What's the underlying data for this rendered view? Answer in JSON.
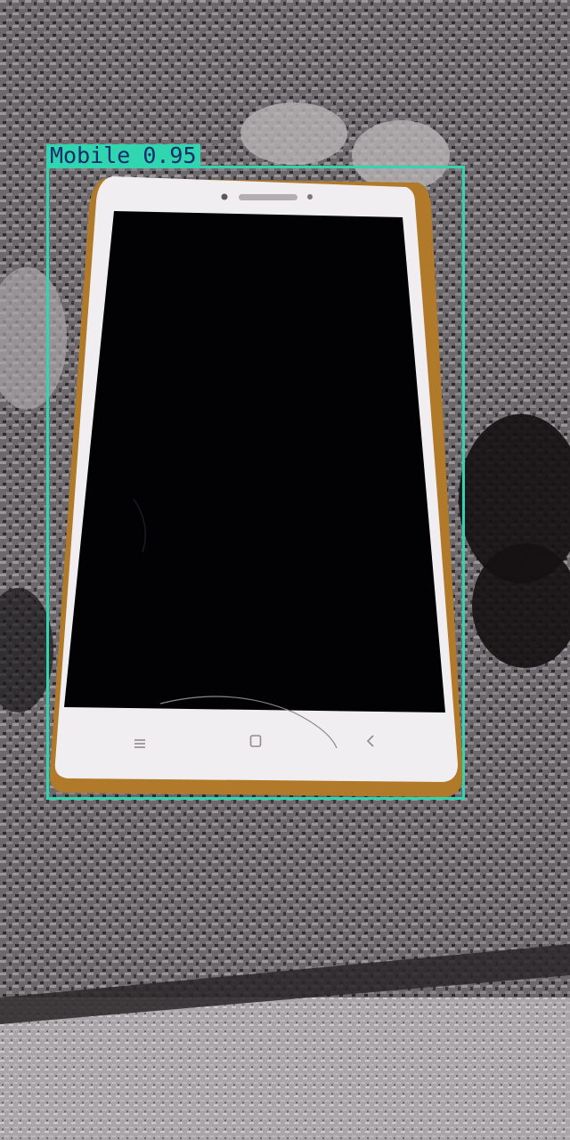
{
  "detection": {
    "class_label": "Mobile",
    "confidence": "0.95",
    "box_color": "#2fd6b0",
    "label_text_color": "#1b2a6b"
  },
  "phone": {
    "nav_icons": [
      "menu-icon",
      "home-square-icon",
      "back-chevron-icon"
    ],
    "body_color": "#f1eef2",
    "screen_color": "#020104",
    "frame_color": "#b07a2a"
  }
}
